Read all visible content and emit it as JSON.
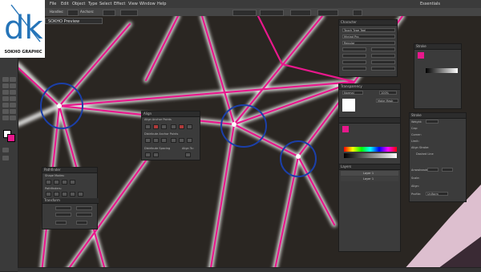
{
  "logo": {
    "text": "SOKHO GRAPHIC",
    "mark": "dk"
  },
  "menu": {
    "items": [
      "File",
      "Edit",
      "Object",
      "Type",
      "Select",
      "Effect",
      "View",
      "Window",
      "Help"
    ],
    "workspace": "Essentials"
  },
  "control_bar": {
    "selection_label": "Handles:",
    "anchors_label": "Anchors:"
  },
  "document": {
    "tab_title": "SOKHO Preview"
  },
  "panels": {
    "align": {
      "title": "Align",
      "section1": "Align Anchor Points",
      "section2": "Distribute Anchor Points",
      "section3": "Distribute Spacing",
      "align_to": "Align To:"
    },
    "pathfinder": {
      "title": "Pathfinder",
      "shape_modes": "Shape Modes:",
      "pathfinders": "Pathfinders:",
      "transform_tab": "Transform"
    },
    "character": {
      "title": "Character",
      "font_family": "Myriad Pro",
      "font_style": "Regular",
      "search_placeholder": "Touch Type Tool"
    },
    "stroke": {
      "title": "Stroke"
    },
    "transparency": {
      "title": "Transparency",
      "mode": "Normal",
      "opacity": "100%",
      "make_mask": "Make Mask"
    },
    "layers": {
      "title": "Layers",
      "layer1": "Layer 1",
      "layer2": "Layer 1"
    },
    "gradient": {
      "title": "Gradient"
    },
    "stroke2": {
      "title": "Stroke",
      "weight_label": "Weight:",
      "cap_label": "Cap:",
      "corner_label": "Corner:",
      "limit_label": "Limit:",
      "align_label": "Align Stroke:",
      "dashed_label": "Dashed Line",
      "arrowheads_label": "Arrowheads:",
      "scale_label": "Scale:",
      "align2_label": "Align:",
      "profile_label": "Profile:",
      "profile_value": "Uniform"
    }
  },
  "colors": {
    "accent_pink": "#e8188c",
    "highlight_blue": "#1b3fa8",
    "canvas": "#262626",
    "glow": "#ffffff"
  }
}
